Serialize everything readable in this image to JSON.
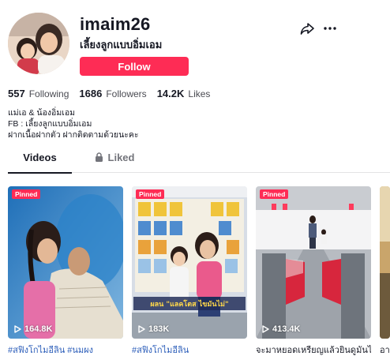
{
  "profile": {
    "username": "imaim26",
    "nickname": "เลี้ยงลูกแบบอิ่มเอม",
    "follow_label": "Follow",
    "bio_lines": [
      "แม่เอ & น้องอิ่มเอม",
      "FB : เลี้ยงลูกแบบอิ่มเอม",
      "ฝากเนื้อฝากตัว ฝากติดตามด้วยนะคะ"
    ]
  },
  "stats": [
    {
      "value": "557",
      "label": "Following"
    },
    {
      "value": "1686",
      "label": "Followers"
    },
    {
      "value": "14.2K",
      "label": "Likes"
    }
  ],
  "tabs": {
    "videos": "Videos",
    "liked": "Liked"
  },
  "icons": {
    "share": "share-icon",
    "more": "more-icon",
    "lock": "lock-icon",
    "play": "play-icon"
  },
  "colors": {
    "accent": "#fe2c55",
    "hashtag": "#2b5db9"
  },
  "videos": [
    {
      "badge": "Pinned",
      "views": "164.8K",
      "caption": "#สฟิงโกไมอีลิน #นมผง"
    },
    {
      "badge": "Pinned",
      "views": "183K",
      "caption": "#สฟิงโกไมอีลิน",
      "overlay_text": "ผลน \"แลคโตส ไขมันไม่\""
    },
    {
      "badge": "Pinned",
      "views": "413.4K",
      "caption": "จะมาหยอดเหรียญแล้วยินดูมันไม่"
    },
    {
      "caption": "อา"
    }
  ]
}
